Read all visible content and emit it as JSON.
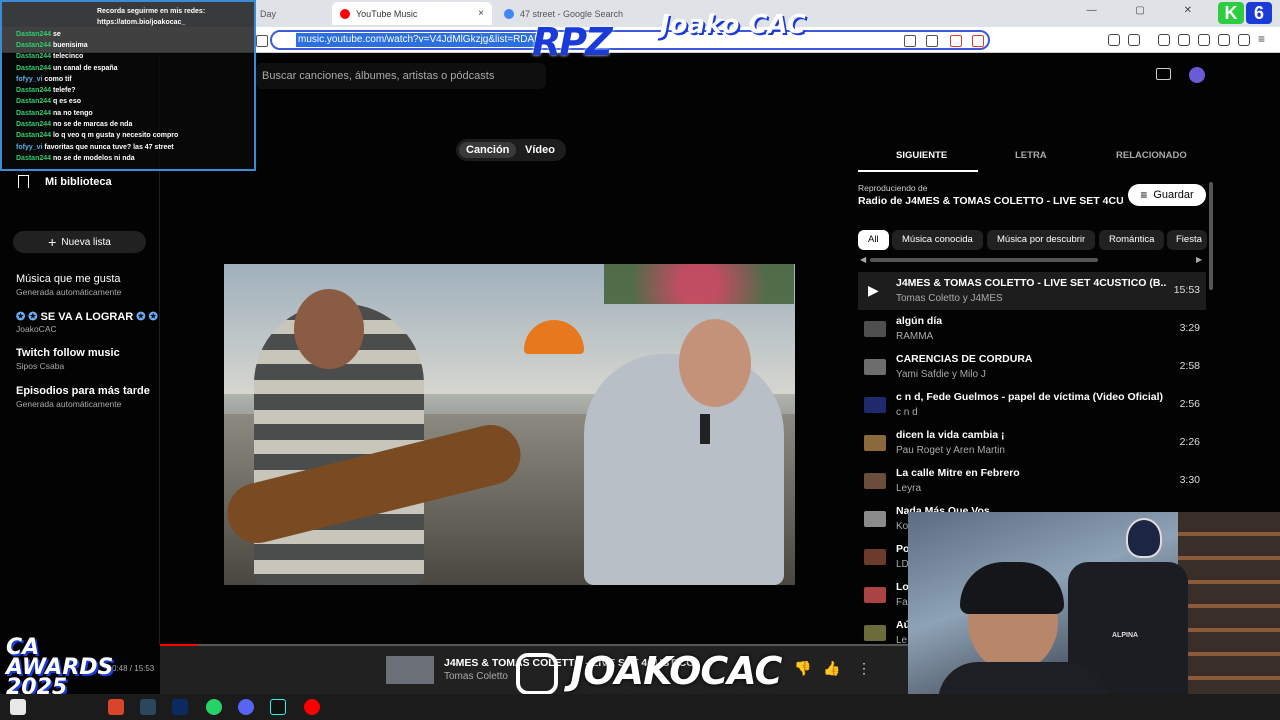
{
  "browser": {
    "tabs": [
      {
        "label": "Day",
        "active": false
      },
      {
        "label": "YouTube Music",
        "active": true,
        "close": "×"
      },
      {
        "label": "47 street - Google Search",
        "active": false
      }
    ],
    "url": "music.youtube.com/watch?v=V4JdMlGkzjg&list=RDAMVM",
    "window_controls": "—  ▢  ✕"
  },
  "app": {
    "search_placeholder": "Buscar canciones, álbumes, artistas o pódcasts",
    "sidebar": {
      "library": "Mi biblioteca",
      "new_list": "Nueva lista",
      "playlists": [
        {
          "name": "Música que me gusta",
          "owner": "Generada automáticamente"
        },
        {
          "name": "SE VA A LOGRAR",
          "owner": "JoakoCAC"
        },
        {
          "name": "Twitch follow music",
          "owner": "Sipos Csaba"
        },
        {
          "name": "Episodios para más tarde",
          "owner": "Generada automáticamente"
        }
      ]
    },
    "toggle": {
      "song": "Canción",
      "video": "Vídeo"
    },
    "panel": {
      "tabs": [
        "SIGUIENTE",
        "LETRA",
        "RELACIONADO"
      ],
      "playing_from_label": "Reproduciendo de",
      "playing_from": "Radio de J4MES & TOMAS COLETTO - LIVE SET 4CUS...",
      "save": "Guardar",
      "chips": [
        "All",
        "Música conocida",
        "Música por descubrir",
        "Romántica",
        "Fiesta"
      ],
      "queue": [
        {
          "title": "J4MES & TOMAS COLETTO - LIVE SET 4CUSTICO (B...",
          "artist": "Tomas Coletto y J4MES",
          "duration": "15:53"
        },
        {
          "title": "algún día",
          "artist": "RAMMA",
          "duration": "3:29"
        },
        {
          "title": "CARENCIAS DE CORDURA",
          "artist": "Yami Safdie y Milo J",
          "duration": "2:58"
        },
        {
          "title": "c n d, Fede Guelmos - papel de víctima (Video Oficial)",
          "artist": "c n d",
          "duration": "2:56"
        },
        {
          "title": "dicen la vida cambia ¡",
          "artist": "Pau Roget y Aren Martin",
          "duration": "2:26"
        },
        {
          "title": "La calle Mitre en Febrero",
          "artist": "Leyra",
          "duration": "3:30"
        },
        {
          "title": "Nada Más Que Vos",
          "artist": "Ko",
          "duration": ""
        },
        {
          "title": "Po",
          "artist": "LD",
          "duration": ""
        },
        {
          "title": "Lo",
          "artist": "Fa",
          "duration": ""
        },
        {
          "title": "Aú",
          "artist": "Le",
          "duration": ""
        }
      ]
    },
    "player": {
      "time": "0:48 / 15:53",
      "title": "J4MES & TOMAS COLETTO - LIVE SET 4CUSTICO",
      "artist": "Tomas Coletto",
      "progress": 0.05
    }
  },
  "overlays": {
    "chat": [
      {
        "user": "",
        "msg": "Recorda seguirme en mis redes:"
      },
      {
        "user": "",
        "msg": "https://atom.bio/joakocac_"
      },
      {
        "user": "Dastan244",
        "msg": "se"
      },
      {
        "user": "Dastan244",
        "msg": "buenisima"
      },
      {
        "user": "Dastan244",
        "msg": "telecinco"
      },
      {
        "user": "Dastan244",
        "msg": "un canal de españa"
      },
      {
        "user": "fofyy_vi",
        "msg": "como tif"
      },
      {
        "user": "Dastan244",
        "msg": "telefe?"
      },
      {
        "user": "Dastan244",
        "msg": "q es eso"
      },
      {
        "user": "Dastan244",
        "msg": "na no tengo"
      },
      {
        "user": "Dastan244",
        "msg": "no se de marcas de nda"
      },
      {
        "user": "Dastan244",
        "msg": "lo q veo q m gusta y necesito compro"
      },
      {
        "user": "fofyy_vi",
        "msg": "favoritas que nunca tuve? las 47 street"
      },
      {
        "user": "Dastan244",
        "msg": "no se de modelos ni nda"
      }
    ],
    "logo_text": "Joako CAC",
    "watermark": "JOAKOCAC",
    "awards": "CA AWARDS 2025",
    "webcam_label": "ALPINA"
  },
  "colors": {
    "accent": "#ff0000",
    "chat_border": "#3a8bd8",
    "chat_user": "#2ecc71"
  }
}
